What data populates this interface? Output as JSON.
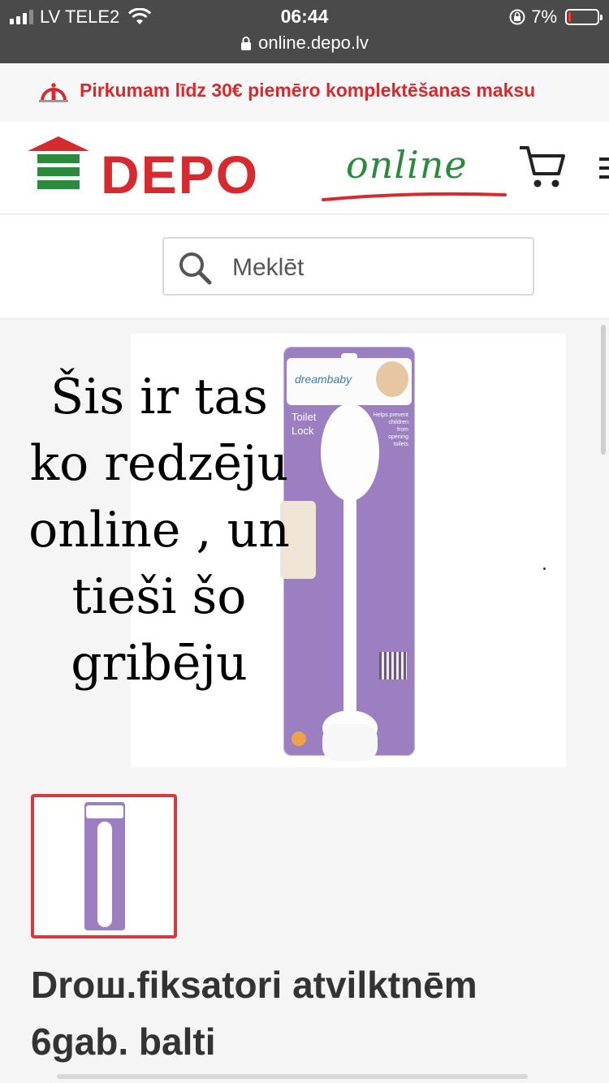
{
  "status_bar": {
    "carrier": "LV TELE2",
    "time": "06:44",
    "battery_percent": "7%",
    "battery_level": 0.07,
    "url": "online.depo.lv"
  },
  "notice": {
    "text": "Pirkumam līdz 30€ piemēro komplektēšanas maksu",
    "color": "#d72a2f"
  },
  "header": {
    "logo_text": "DEPO",
    "logo_suffix": "online",
    "brand_red": "#d72a2f",
    "brand_green": "#2b8a3e",
    "cart_icon": "cart-icon",
    "menu_icon": "hamburger-icon"
  },
  "search": {
    "placeholder": "Meklēt",
    "icon": "search-icon"
  },
  "product_image": {
    "brand": "dreambaby",
    "package_title_line1": "Toilet",
    "package_title_line2": "Lock",
    "package_note": [
      "Helps prevent",
      "children",
      "from",
      "opening",
      "toilets"
    ]
  },
  "overlay_caption": {
    "lines": [
      "Šis ir tas",
      "ko redzēju",
      "online , un",
      "tieši šo",
      "gribēju"
    ]
  },
  "product": {
    "title_line1": "Drош.fiksatori atvilktnēm",
    "title_line2": "6gab. balti"
  }
}
